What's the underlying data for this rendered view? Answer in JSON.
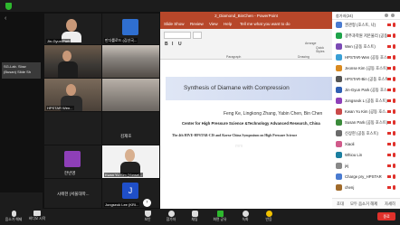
{
  "topbar": {
    "speaker_view_label": "",
    "shield_color": "#2eb82e"
  },
  "left_strip": {
    "name_1": "SG-Lab. Slow",
    "name_2": "(Busan) Slide Sh"
  },
  "gallery": {
    "tiles": [
      {
        "name": "Jin-Gyun Park"
      },
      {
        "name": "만다를로드 (김선국..."
      },
      {
        "name": ""
      },
      {
        "name": ""
      },
      {
        "name": "HPSTAR Wen..."
      },
      {
        "name": ""
      },
      {
        "name": ""
      },
      {
        "name": "김재호"
      },
      {
        "name": "한빈영"
      },
      {
        "name": "Kwan Yu Kim (Yonsei..."
      },
      {
        "name": "시에헌 (서울대학..."
      },
      {
        "name": "Jongseok Lee (KRI..."
      }
    ],
    "avatar_letter": "J",
    "purple_color": "#8e3fb8",
    "blue_color": "#1f4fc8"
  },
  "ppt": {
    "window_title": "2_Diamond_BinChen - PowerPoint",
    "menu": [
      "Slide Show",
      "Review",
      "View",
      "Help",
      "Tell me what you want to do"
    ],
    "ribbon": {
      "paragraph": "Paragraph",
      "drawing": "Drawing",
      "arrange": "Arrange",
      "quick_styles": "Quick Styles"
    },
    "slide": {
      "title": "Synthesis of Diamane with Compression",
      "authors": "Feng Ke, Lingkong Zhang, Yabin Chen, Bin Chen",
      "center": "Center for High Pressure Science &Technology Advanced Research, China",
      "symposium": "The 4th HIVE-HPSTAR-CIS and Korea-China Symposium on High Pressure Science",
      "faint": "mm"
    },
    "accent": "#b7472a"
  },
  "participants": {
    "title": "참가자(24)",
    "rows": [
      {
        "name": "권관형 (호스트, 나)",
        "color": "#4a7bd0"
      },
      {
        "name": "광주과학원 저온물리 (공동...",
        "color": "#1ea34a"
      },
      {
        "name": "Wen (공동 호스트)",
        "color": "#7b4bb5"
      },
      {
        "name": "HPSTAR-Wen (공동 호스트)",
        "color": "#3a9fd5"
      },
      {
        "name": "Jeonse Kim (공동 호스트)",
        "color": "#d98a20"
      },
      {
        "name": "HPSTAR-Bin (공동 호스트)",
        "color": "#555555"
      },
      {
        "name": "Jin-Gyun Park (공동 호스...",
        "color": "#2f5fb3"
      },
      {
        "name": "Jongseok L (공동 호스트)",
        "color": "#8e3fb8"
      },
      {
        "name": "Kwan Yu Kim (공동 호스...",
        "color": "#c94a4a"
      },
      {
        "name": "Susan Park (공동 호스트)",
        "color": "#3b8b3b"
      },
      {
        "name": "신상현 (공동 호스트)",
        "color": "#6a6a6a"
      },
      {
        "name": "Xiaoli",
        "color": "#d05a8a"
      },
      {
        "name": "Whiou Lin",
        "color": "#1b7fa0"
      },
      {
        "name": "jej",
        "color": "#888888"
      },
      {
        "name": "Charge pry_HPSTAR",
        "color": "#4a7bd0"
      },
      {
        "name": "chenj",
        "color": "#a06a2a"
      }
    ],
    "footer": {
      "invite": "초대",
      "mute_all": "모두 음소거 해제",
      "more": "자세히"
    }
  },
  "toolbar": {
    "items": [
      {
        "label": "음소거 해제"
      },
      {
        "label": "비디오 시작"
      },
      {
        "label": "보안"
      },
      {
        "label": "참가자"
      },
      {
        "label": "채팅"
      },
      {
        "label": "화면 공유"
      },
      {
        "label": "녹화"
      },
      {
        "label": "반응"
      }
    ],
    "end_label": "종료",
    "share_color": "#2eb82e"
  }
}
